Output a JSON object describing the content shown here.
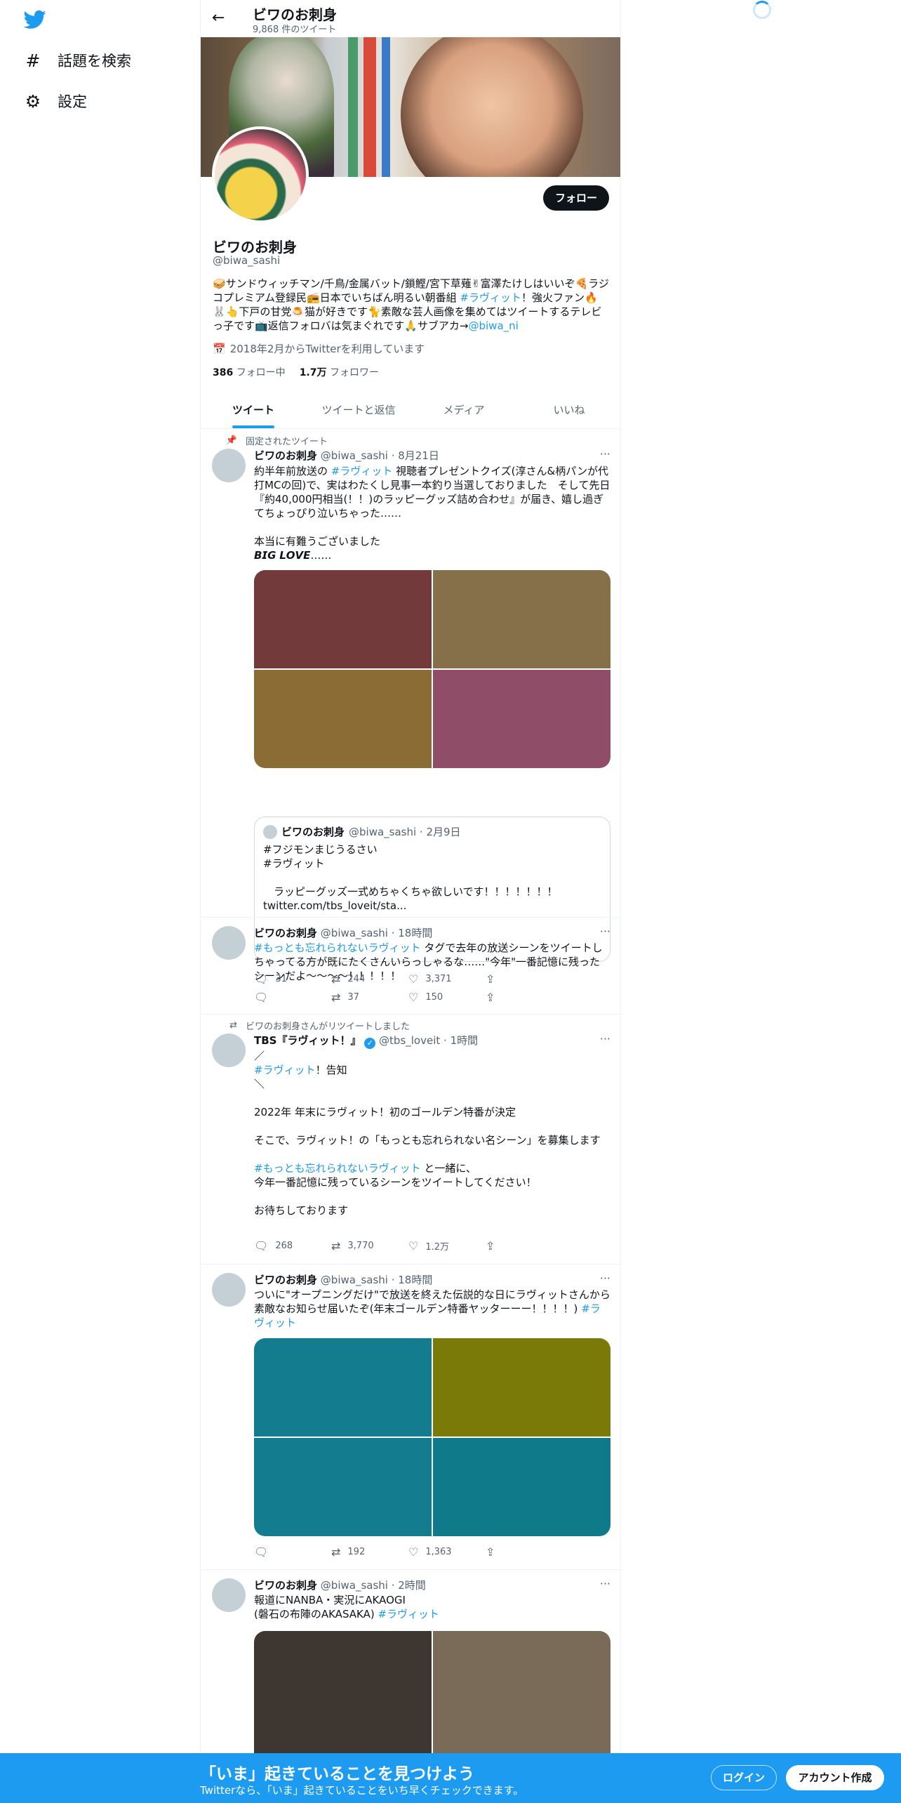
{
  "sidebar": {
    "explore_label": "話題を検索",
    "settings_label": "設定"
  },
  "header": {
    "title": "ビワのお刺身",
    "tweet_count": "9,868 件のツイート"
  },
  "profile": {
    "follow_label": "フォロー",
    "name": "ビワのお刺身",
    "handle": "@biwa_sashi",
    "bio_text": "🥪サンドウィッチマン/千鳥/金属バット/鎖鰹/宮下草薙✌富澤たけしはいいぞ🍕ラジコプレミアム登録民📻日本でいちばん明るい朝番組",
    "bio_hashtag": "#ラヴィット",
    "bio_text2": "！強火ファン🔥🐰👆下戸の甘党🍮猫が好きです🐈素敵な芸人画像を集めてはツイートするテレビっ子です📺返信フォロバは気まぐれです🙏サブアカ→",
    "bio_link": "@biwa_ni",
    "joined": "2018年2月からTwitterを利用しています",
    "following_count": "386",
    "following_label": "フォロー中",
    "followers_count": "1.7万",
    "followers_label": "フォロワー"
  },
  "tabs": [
    "ツイート",
    "ツイートと返信",
    "メディア",
    "いいね"
  ],
  "tweets": [
    {
      "context": "固定されたツイート",
      "name": "ビワのお刺身",
      "meta": "@biwa_sashi · 8月21日",
      "body_pre": "約半年前放送の ",
      "body_tag": "#ラヴィット",
      "body_post": " 視聴者プレゼントクイズ(淳さん&柄パンが代打MCの回)で、実はわたくし見事一本釣り当選しておりました　そして先日『約40,000円相当(！！)のラッピーグッズ詰め合わせ』が届き、嬉し過ぎてちょっぴり泣いちゃった……\n\n本当に有難うございました\n𝘽𝙄𝙂 𝙇𝙊𝙑𝙀……",
      "media_colors": [
        "#733a3c",
        "#86704a",
        "#8a6c34",
        "#8f4d67"
      ],
      "quote": {
        "name": "ビワのお刺身",
        "meta": "@biwa_sashi · 2月9日",
        "body": "#フジモンまじうるさい\n#ラヴィット\n\n　ラッピーグッズ一式めちゃくちゃ欲しいです！！！！！！！\ntwitter.com/tbs_loveit/sta..."
      },
      "reply": "31",
      "retweet": "244",
      "like": "3,371"
    },
    {
      "name": "ビワのお刺身",
      "meta": "@biwa_sashi · 18時間",
      "body_tag": "#もっとも忘れられないラヴィット",
      "body_post": " タグで去年の放送シーンをツイートしちゃってる方が既にたくさんいらっしゃるな……\"今年\"一番記憶に残ったシーンだよ～～～～！！！！！",
      "reply": "",
      "retweet": "37",
      "like": "150"
    },
    {
      "context": "ビワのお刺身さんがリツイートしました",
      "name": "TBS『ラヴィット！』",
      "meta": "@tbs_loveit · 1時間",
      "body_line1": "／",
      "body_tag": "#ラヴィット",
      "body_line2": "！告知",
      "body_line3": "＼\n\n2022年 年末にラヴィット！初のゴールデン特番が決定\n\nそこで、ラヴィット！の「もっとも忘れられない名シーン」を募集します\n\n",
      "body_tag2": "#もっとも忘れられないラヴィット",
      "body_post": " と一緒に、\n今年一番記憶に残っているシーンをツイートしてください！\n\nお待ちしております",
      "reply": "268",
      "retweet": "3,770",
      "like": "1.2万"
    },
    {
      "name": "ビワのお刺身",
      "meta": "@biwa_sashi · 18時間",
      "body_pre": "ついに\"オープニングだけ\"で放送を終えた伝説的な日にラヴィットさんから素敵なお知らせ届いたぞ(年末ゴールデン特番ヤッターーー！！！！) ",
      "body_tag": "#ラヴィット",
      "media_colors": [
        "#137d8f",
        "#7a7a08",
        "#137d8f",
        "#0f7a8a"
      ],
      "reply": "",
      "retweet": "192",
      "like": "1,363"
    },
    {
      "name": "ビワのお刺身",
      "meta": "@biwa_sashi · 2時間",
      "body_pre": "報道にNANBA・実況にAKAOGI\n(磐石の布陣のAKASAKA) ",
      "body_tag": "#ラヴィット",
      "media_colors": [
        "#3d3631",
        "#7a6a58"
      ]
    }
  ],
  "bottombar": {
    "title": "「いま」起きていることを見つけよう",
    "subtitle": "Twitterなら、「いま」起きていることをいち早くチェックできます。",
    "login_label": "ログイン",
    "signup_label": "アカウント作成"
  }
}
